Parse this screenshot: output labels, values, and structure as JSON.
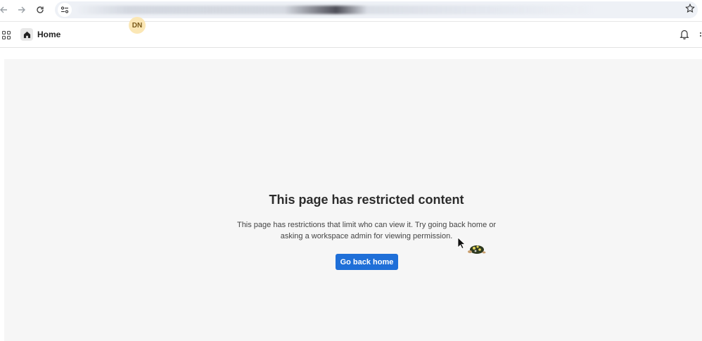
{
  "browser": {
    "back_icon": "arrow-left-icon",
    "forward_icon": "arrow-right-icon",
    "reload_icon": "reload-icon",
    "site_info_icon": "tune-icon",
    "bookmark_icon": "star-icon"
  },
  "header": {
    "apps_icon": "grid-icon",
    "home_icon": "home-icon",
    "title": "Home",
    "avatar_initials": "DN",
    "notifications_icon": "bell-icon"
  },
  "main": {
    "title": "This page has restricted content",
    "description": "This page has restrictions that limit who can view it. Try going back home or asking a workspace admin for viewing permission.",
    "button_label": "Go back home"
  },
  "colors": {
    "accent": "#1f6fd8",
    "avatar_bg": "#fbe7b5",
    "content_bg": "#f6f6f6"
  }
}
